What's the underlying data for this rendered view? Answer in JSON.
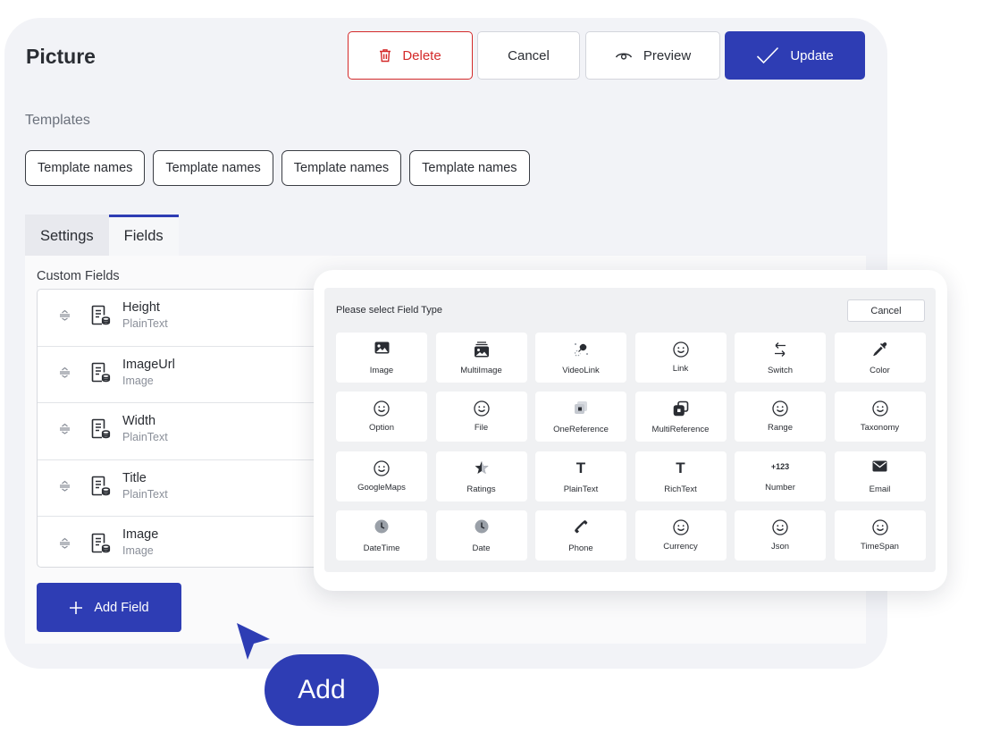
{
  "page": {
    "title": "Picture"
  },
  "header_actions": {
    "delete_label": "Delete",
    "cancel_label": "Cancel",
    "preview_label": "Preview",
    "update_label": "Update"
  },
  "templates": {
    "label": "Templates",
    "items": [
      "Template names",
      "Template names",
      "Template names",
      "Template names"
    ]
  },
  "tabs": [
    {
      "label": "Settings",
      "active": false
    },
    {
      "label": "Fields",
      "active": true
    }
  ],
  "custom_fields": {
    "label": "Custom Fields",
    "items": [
      {
        "name": "Height",
        "type": "PlainText"
      },
      {
        "name": "ImageUrl",
        "type": "Image"
      },
      {
        "name": "Width",
        "type": "PlainText"
      },
      {
        "name": "Title",
        "type": "PlainText"
      },
      {
        "name": "Image",
        "type": "Image"
      }
    ],
    "add_label": "Add Field"
  },
  "callout": {
    "label": "Add"
  },
  "field_type_dialog": {
    "title": "Please select Field Type",
    "cancel_label": "Cancel",
    "types": [
      {
        "label": "Image",
        "icon": "image-icon"
      },
      {
        "label": "MultiImage",
        "icon": "multi-image-icon"
      },
      {
        "label": "VideoLink",
        "icon": "video-link-icon"
      },
      {
        "label": "Link",
        "icon": "smiley-icon"
      },
      {
        "label": "Switch",
        "icon": "switch-arrows-icon"
      },
      {
        "label": "Color",
        "icon": "eyedropper-icon"
      },
      {
        "label": "Option",
        "icon": "smiley-icon"
      },
      {
        "label": "File",
        "icon": "smiley-icon"
      },
      {
        "label": "OneReference",
        "icon": "one-reference-icon"
      },
      {
        "label": "MultiReference",
        "icon": "multi-reference-icon"
      },
      {
        "label": "Range",
        "icon": "smiley-icon"
      },
      {
        "label": "Taxonomy",
        "icon": "smiley-icon"
      },
      {
        "label": "GoogleMaps",
        "icon": "smiley-icon"
      },
      {
        "label": "Ratings",
        "icon": "star-icon"
      },
      {
        "label": "PlainText",
        "icon": "text-t-icon"
      },
      {
        "label": "RichText",
        "icon": "text-t-icon"
      },
      {
        "label": "Number",
        "icon": "number-icon",
        "glyph": "+123"
      },
      {
        "label": "Email",
        "icon": "envelope-icon"
      },
      {
        "label": "DateTime",
        "icon": "clock-icon"
      },
      {
        "label": "Date",
        "icon": "clock-icon"
      },
      {
        "label": "Phone",
        "icon": "phone-icon"
      },
      {
        "label": "Currency",
        "icon": "smiley-icon"
      },
      {
        "label": "Json",
        "icon": "smiley-icon"
      },
      {
        "label": "TimeSpan",
        "icon": "smiley-icon"
      }
    ]
  },
  "colors": {
    "primary": "#2e3db4",
    "danger": "#d42a2a",
    "panel_background": "#f2f3f7"
  }
}
